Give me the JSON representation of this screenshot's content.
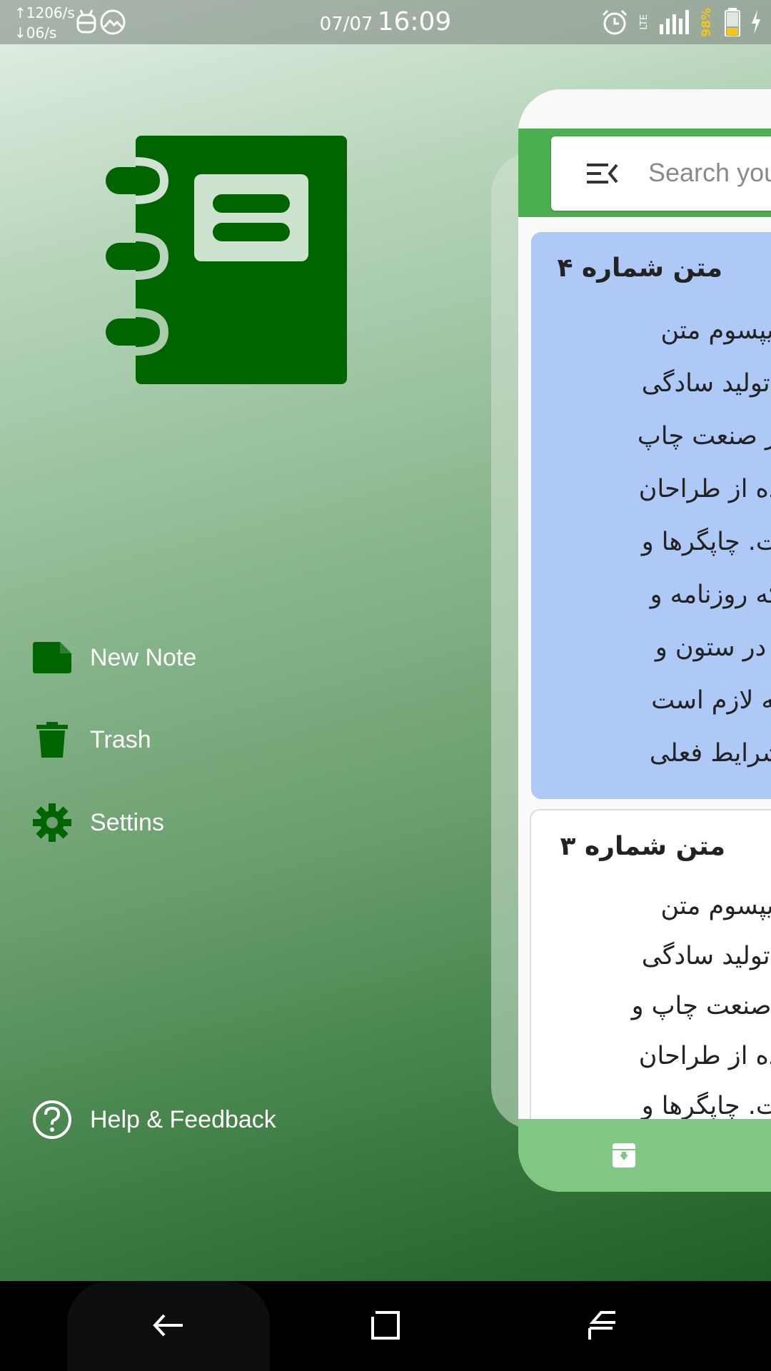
{
  "status_bar": {
    "net_up": "↑1206/s",
    "net_down": "↓06/s",
    "date": "07/07",
    "time": "16:09",
    "network_type": "LTE",
    "battery": "98%"
  },
  "drawer": {
    "logo": "notebook-icon",
    "menu": [
      {
        "label": "New Note",
        "icon": "note-icon"
      },
      {
        "label": "Trash",
        "icon": "trash-icon"
      },
      {
        "label": "Settins",
        "icon": "gear-icon"
      }
    ],
    "help_label": "Help & Feedback"
  },
  "app_preview": {
    "search_placeholder": "Search you",
    "notes": [
      {
        "title": "متن شماره ۴",
        "color": "#aec9f5",
        "lines": [
          "لورم ایپسوم متن",
          "ختگی با تولید سادگی",
          "مفهوم از صنعت چاپ",
          "با استفاده از طراحان",
          "فیک است. چاپگرها و",
          "متون بلکه روزنامه و",
          "مجله در ستون و",
          "آنچنان که لازم است",
          "و برای شرایط فعلی"
        ]
      },
      {
        "title": "متن شماره ۳",
        "color": "#ffffff",
        "lines": [
          "لورم ایپسوم متن",
          "ختگی با تولید سادگی",
          "فهوم از صنعت چاپ و",
          "با استفاده از طراحان",
          "فیک است. چاپگرها و"
        ]
      }
    ]
  },
  "colors": {
    "brand_dark_green": "#006400",
    "app_green": "#4caf50",
    "bottom_bar_green": "#81c784",
    "note_blue": "#aec9f5"
  }
}
